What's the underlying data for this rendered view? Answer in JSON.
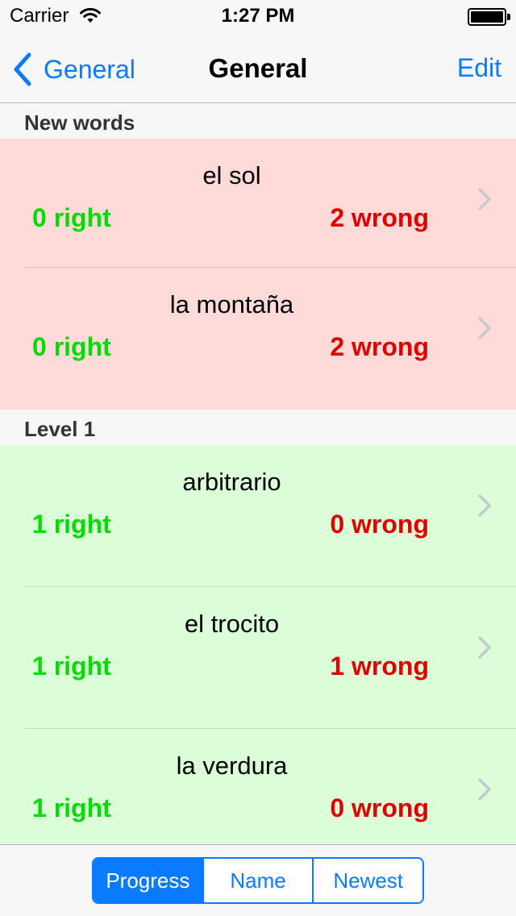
{
  "status_bar": {
    "carrier": "Carrier",
    "time": "1:27 PM",
    "icons": [
      "wifi-icon",
      "battery-icon"
    ]
  },
  "nav": {
    "back_label": "General",
    "title": "General",
    "edit_label": "Edit"
  },
  "sections": [
    {
      "header": "New words",
      "rows": [
        {
          "word": "el sol",
          "right": "0 right",
          "wrong": "2 wrong"
        },
        {
          "word": "la montaña",
          "right": "0 right",
          "wrong": "2 wrong"
        }
      ]
    },
    {
      "header": "Level 1",
      "rows": [
        {
          "word": "arbitrario",
          "right": "1 right",
          "wrong": "0 wrong"
        },
        {
          "word": "el trocito",
          "right": "1 right",
          "wrong": "1 wrong"
        },
        {
          "word": "la verdura",
          "right": "1 right",
          "wrong": "0 wrong"
        }
      ]
    }
  ],
  "toolbar": {
    "segments": [
      "Progress",
      "Name",
      "Newest"
    ],
    "selected": "Progress"
  },
  "colors": {
    "accent": "#0a7aff",
    "right_text": "#00dd00",
    "wrong_text": "#e00000",
    "new_words_row_bg": "#fedad9",
    "level_row_bg": "#dbfed9",
    "bar_bg": "#f7f7f7"
  }
}
